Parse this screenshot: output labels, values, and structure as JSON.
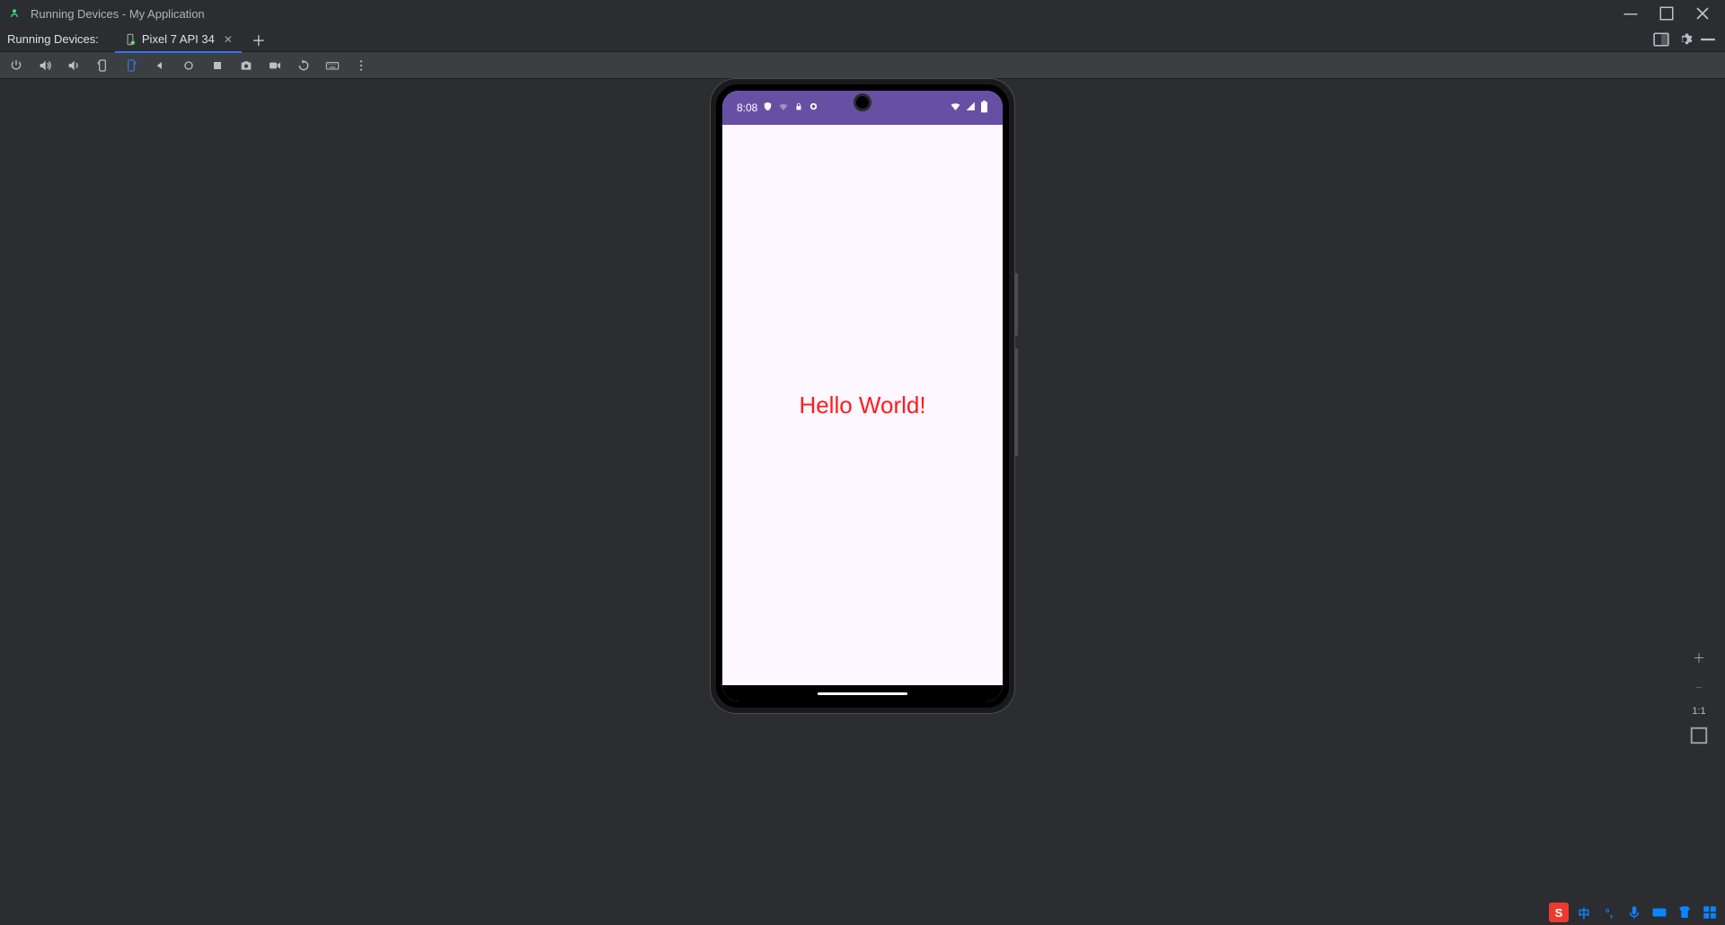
{
  "window": {
    "title": "Running Devices - My Application"
  },
  "tabrow": {
    "label": "Running Devices:",
    "tab_name": "Pixel 7 API 34"
  },
  "device": {
    "status_time": "8:08",
    "app_text": "Hello World!"
  },
  "zoom": {
    "ratio": "1:1"
  },
  "ime": {
    "letter": "S",
    "lang": "中"
  }
}
